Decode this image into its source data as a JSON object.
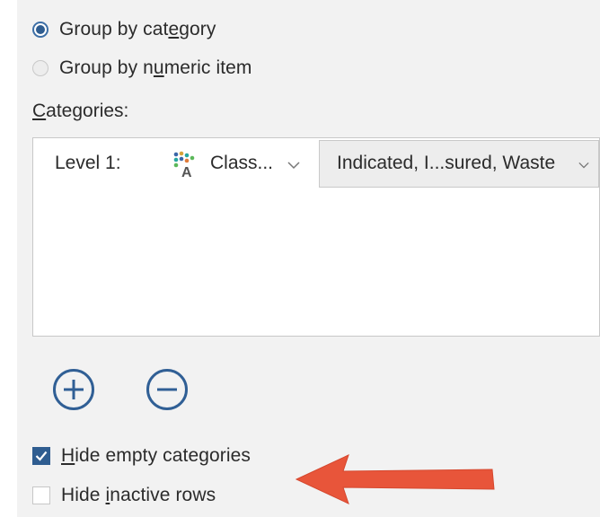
{
  "grouping": {
    "options": [
      {
        "label_before": "Group by cat",
        "label_mnemonic": "e",
        "label_after": "gory",
        "selected": true
      },
      {
        "label_before": "Group by n",
        "label_mnemonic": "u",
        "label_after": "meric item",
        "selected": false
      }
    ]
  },
  "categories": {
    "caption_mnemonic": "C",
    "caption_rest": "ategories:",
    "rows": [
      {
        "level_label": "Level 1:",
        "attribute": "Class...",
        "attribute_icon": "categorical-attribute-icon",
        "values": "Indicated, I...sured, Waste"
      }
    ]
  },
  "buttons": {
    "add_icon": "plus-circle-icon",
    "remove_icon": "minus-circle-icon"
  },
  "options": {
    "hide_empty": {
      "mnemonic": "H",
      "rest": "ide empty categories",
      "checked": true
    },
    "hide_inactive": {
      "before": "Hide ",
      "mnemonic": "i",
      "rest": "nactive rows",
      "checked": false
    }
  },
  "annotation": {
    "arrow_color": "#e8553a",
    "points_to": "Hide empty categories"
  },
  "colors": {
    "accent": "#2f5d90",
    "panel_bg": "#f2f2f2"
  }
}
